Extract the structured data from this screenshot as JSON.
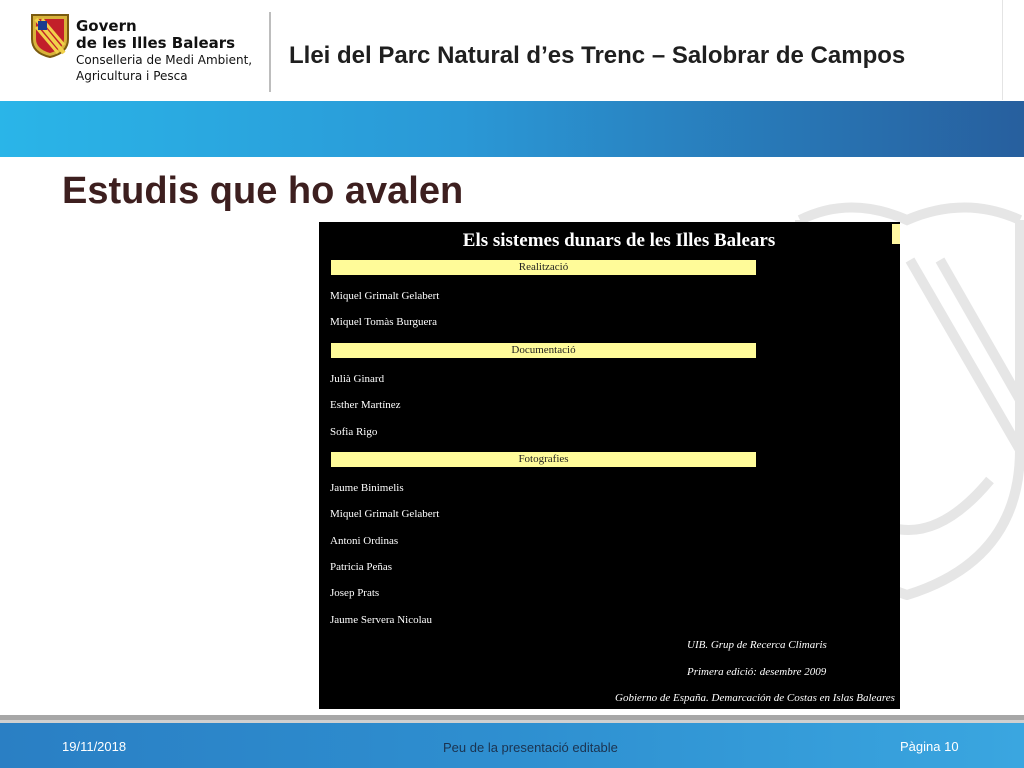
{
  "header": {
    "org_line1": "Govern",
    "org_line2": "de les Illes Balears",
    "org_line3": "Conselleria de Medi Ambient,",
    "org_line4": "Agricultura i Pesca",
    "document_title": "Llei del Parc Natural d’es Trenc – Salobrar de Campos"
  },
  "slide": {
    "title": "Estudis que ho avalen"
  },
  "embedded_image": {
    "title": "Els sistemes dunars de les Illes Balears",
    "sections": [
      {
        "heading": "Realització",
        "names": [
          "Miquel Grimalt Gelabert",
          "Miquel Tomàs Burguera"
        ]
      },
      {
        "heading": "Documentació",
        "names": [
          "Julià Ginard",
          "Esther Martínez",
          "Sofia Rigo"
        ]
      },
      {
        "heading": "Fotografies",
        "names": [
          "Jaume Binimelis",
          "Miquel Grimalt Gelabert",
          "Antoni Ordinas",
          "Patricia Peñas",
          "Josep Prats",
          "Jaume Servera Nicolau"
        ]
      }
    ],
    "credits": [
      "UIB. Grup de Recerca Climaris",
      "Primera edició: desembre 2009",
      "Gobierno de España. Demarcación de Costas en Islas Baleares"
    ]
  },
  "footer": {
    "date": "19/11/2018",
    "center": "Peu de la presentació  editable",
    "page": "Pàgina 10"
  },
  "colors": {
    "band_start": "#2ab5e8",
    "band_end": "#275f9e",
    "title_color": "#3d1f1f",
    "section_bar": "#fffb99",
    "footer": "#2e8fd0"
  }
}
